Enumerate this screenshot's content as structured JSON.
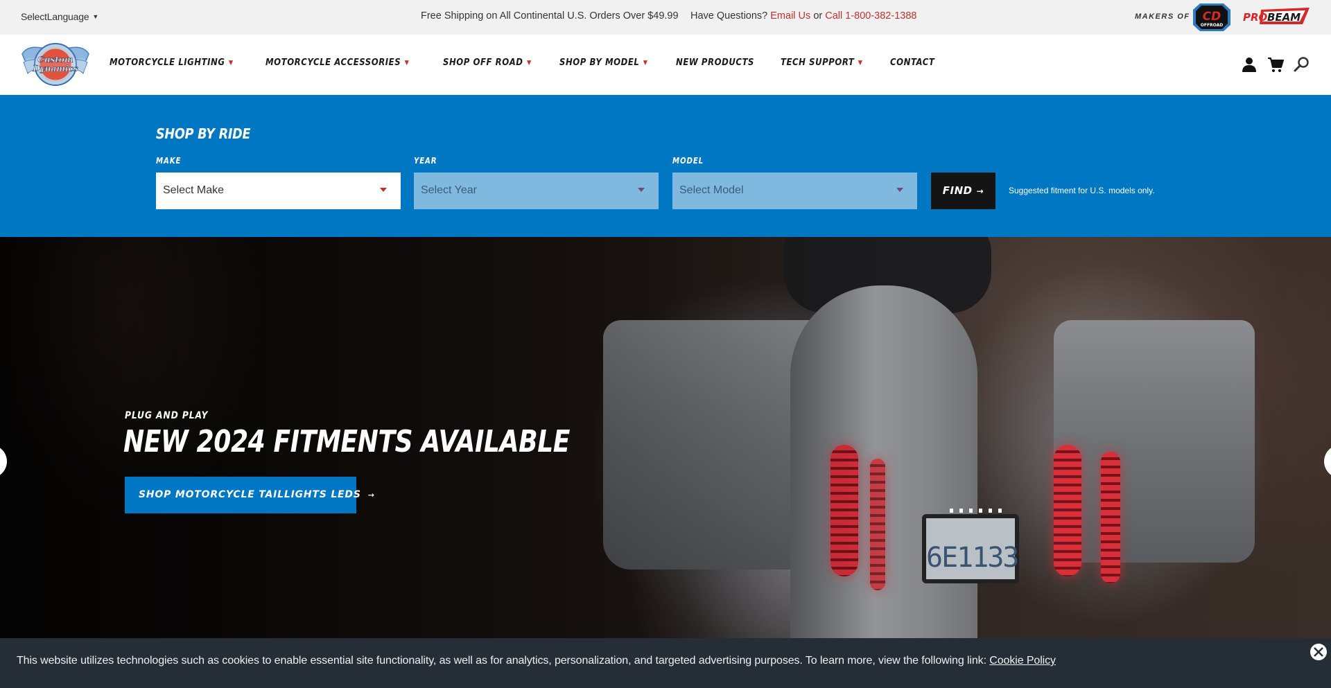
{
  "topbar": {
    "language_label": "SelectLanguage",
    "language_caret": "▼",
    "shipping_text": "Free Shipping on All Continental U.S. Orders Over $49.99",
    "questions_text": "Have Questions?",
    "email_link": "Email Us",
    "or_text": "or",
    "call_link": "Call 1-800-382-1388",
    "makers_of": "MAKERS OF",
    "brand_logos": [
      {
        "name": "CD Offroad",
        "line1": "CD",
        "line2": "OFFROAD"
      },
      {
        "name": "ProBeam",
        "text_red": "PRO",
        "text_dark": "BEAM"
      }
    ]
  },
  "header": {
    "logo_text_line1": "Custom",
    "logo_text_line2": "Dynamics",
    "nav": [
      {
        "label": "MOTORCYCLE LIGHTING",
        "has_dropdown": true
      },
      {
        "label": "MOTORCYCLE ACCESSORIES",
        "has_dropdown": true
      },
      {
        "label": "SHOP OFF ROAD",
        "has_dropdown": true
      },
      {
        "label": "SHOP BY MODEL",
        "has_dropdown": true
      },
      {
        "label": "NEW PRODUCTS",
        "has_dropdown": false
      },
      {
        "label": "TECH SUPPORT",
        "has_dropdown": true
      },
      {
        "label": "CONTACT",
        "has_dropdown": false
      }
    ],
    "dropdown_glyph": "▼",
    "icons": [
      "account-icon",
      "cart-icon",
      "search-icon"
    ]
  },
  "shop_by_ride": {
    "title": "SHOP BY RIDE",
    "make": {
      "label": "MAKE",
      "value": "Select Make",
      "enabled": true
    },
    "year": {
      "label": "YEAR",
      "value": "Select Year",
      "enabled": false
    },
    "model": {
      "label": "MODEL",
      "value": "Select Model",
      "enabled": false
    },
    "find_label": "FIND",
    "find_arrow": "→",
    "note": "Suggested fitment for U.S. models only."
  },
  "hero": {
    "kicker": "PLUG AND PLAY",
    "title": "NEW 2024 FITMENTS AVAILABLE",
    "cta_label": "SHOP MOTORCYCLE TAILLIGHTS LEDS",
    "cta_arrow": "→",
    "plate_text": "6E1133"
  },
  "cookie": {
    "text": "This website utilizes technologies such as cookies to enable essential site functionality, as well as for analytics, personalization, and targeted advertising purposes. To learn more, view the following link: ",
    "link": "Cookie Policy"
  },
  "colors": {
    "brand_blue": "#0077c2",
    "accent_red": "#c42f2f",
    "topbar_bg": "#f1f1f1",
    "cookie_bg": "#252d36",
    "find_bg": "#141414"
  }
}
